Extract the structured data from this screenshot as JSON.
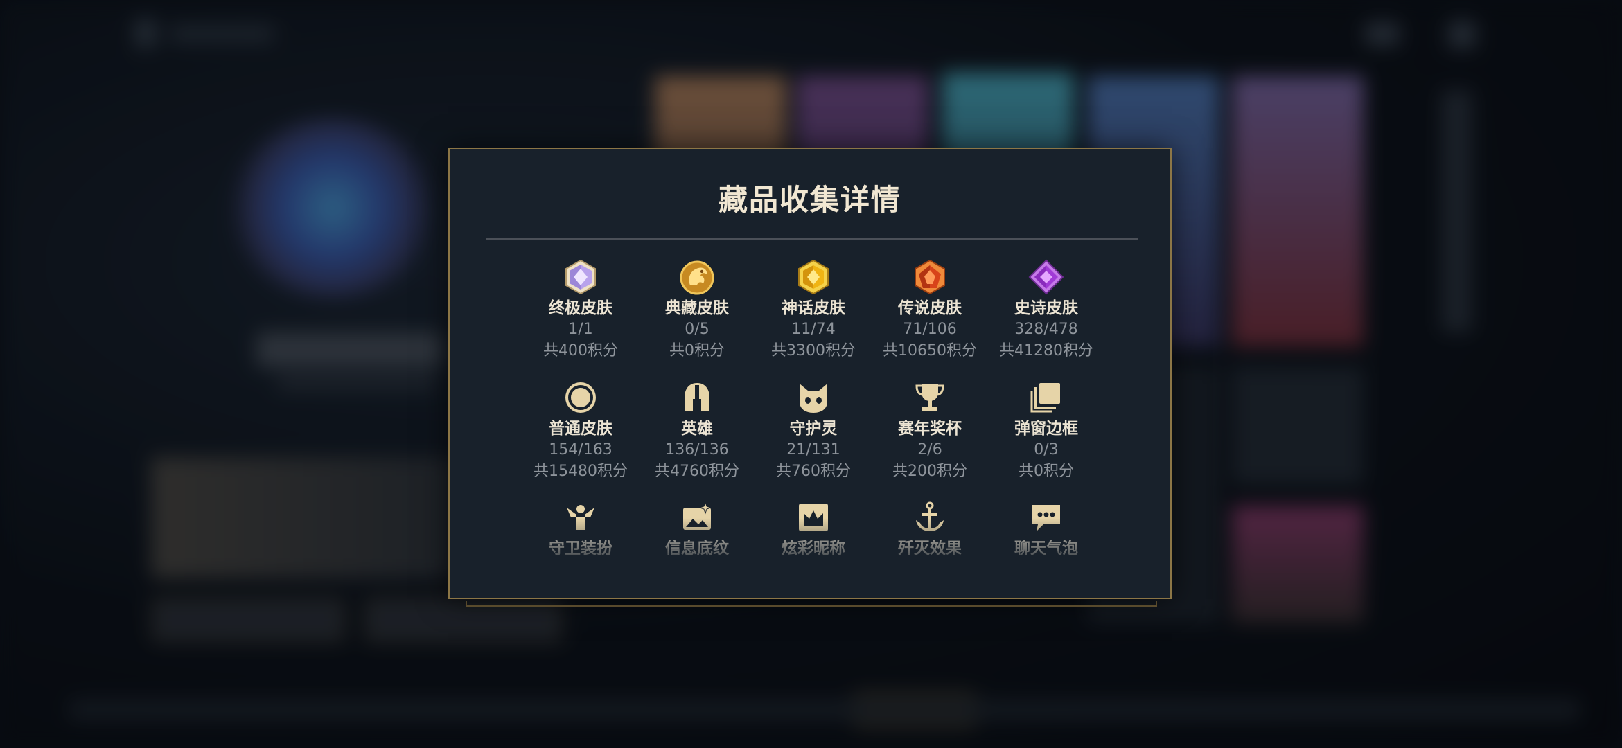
{
  "modal": {
    "title": "藏品收集详情",
    "rows": [
      [
        {
          "icon": "ultimate-skin-gem-icon",
          "name": "终极皮肤",
          "count": "1/1",
          "score": "共400积分"
        },
        {
          "icon": "treasure-skin-dragon-icon",
          "name": "典藏皮肤",
          "count": "0/5",
          "score": "共0积分"
        },
        {
          "icon": "mythic-skin-gem-icon",
          "name": "神话皮肤",
          "count": "11/74",
          "score": "共3300积分"
        },
        {
          "icon": "legendary-skin-gem-icon",
          "name": "传说皮肤",
          "count": "71/106",
          "score": "共10650积分"
        },
        {
          "icon": "epic-skin-gem-icon",
          "name": "史诗皮肤",
          "count": "328/478",
          "score": "共41280积分"
        }
      ],
      [
        {
          "icon": "normal-skin-circle-icon",
          "name": "普通皮肤",
          "count": "154/163",
          "score": "共15480积分"
        },
        {
          "icon": "hero-helmet-icon",
          "name": "英雄",
          "count": "136/136",
          "score": "共4760积分"
        },
        {
          "icon": "guardian-spirit-icon",
          "name": "守护灵",
          "count": "21/131",
          "score": "共760积分"
        },
        {
          "icon": "season-trophy-icon",
          "name": "赛年奖杯",
          "count": "2/6",
          "score": "共200积分"
        },
        {
          "icon": "popup-frame-icon",
          "name": "弹窗边框",
          "count": "0/3",
          "score": "共0积分"
        }
      ],
      [
        {
          "icon": "guard-outfit-icon",
          "name": "守卫装扮"
        },
        {
          "icon": "info-background-icon",
          "name": "信息底纹"
        },
        {
          "icon": "colorful-nickname-icon",
          "name": "炫彩昵称"
        },
        {
          "icon": "annihilation-effect-icon",
          "name": "歼灭效果"
        },
        {
          "icon": "chat-bubble-icon",
          "name": "聊天气泡"
        }
      ]
    ]
  },
  "colors": {
    "modal_bg": "#18212b",
    "modal_border": "#8c7646",
    "title": "#f1e7d2",
    "close_icon": "#f1e7d2",
    "item_name": "#ece4d3",
    "item_meta": "#8e949b",
    "icon_gold": "#e6d4a8"
  }
}
